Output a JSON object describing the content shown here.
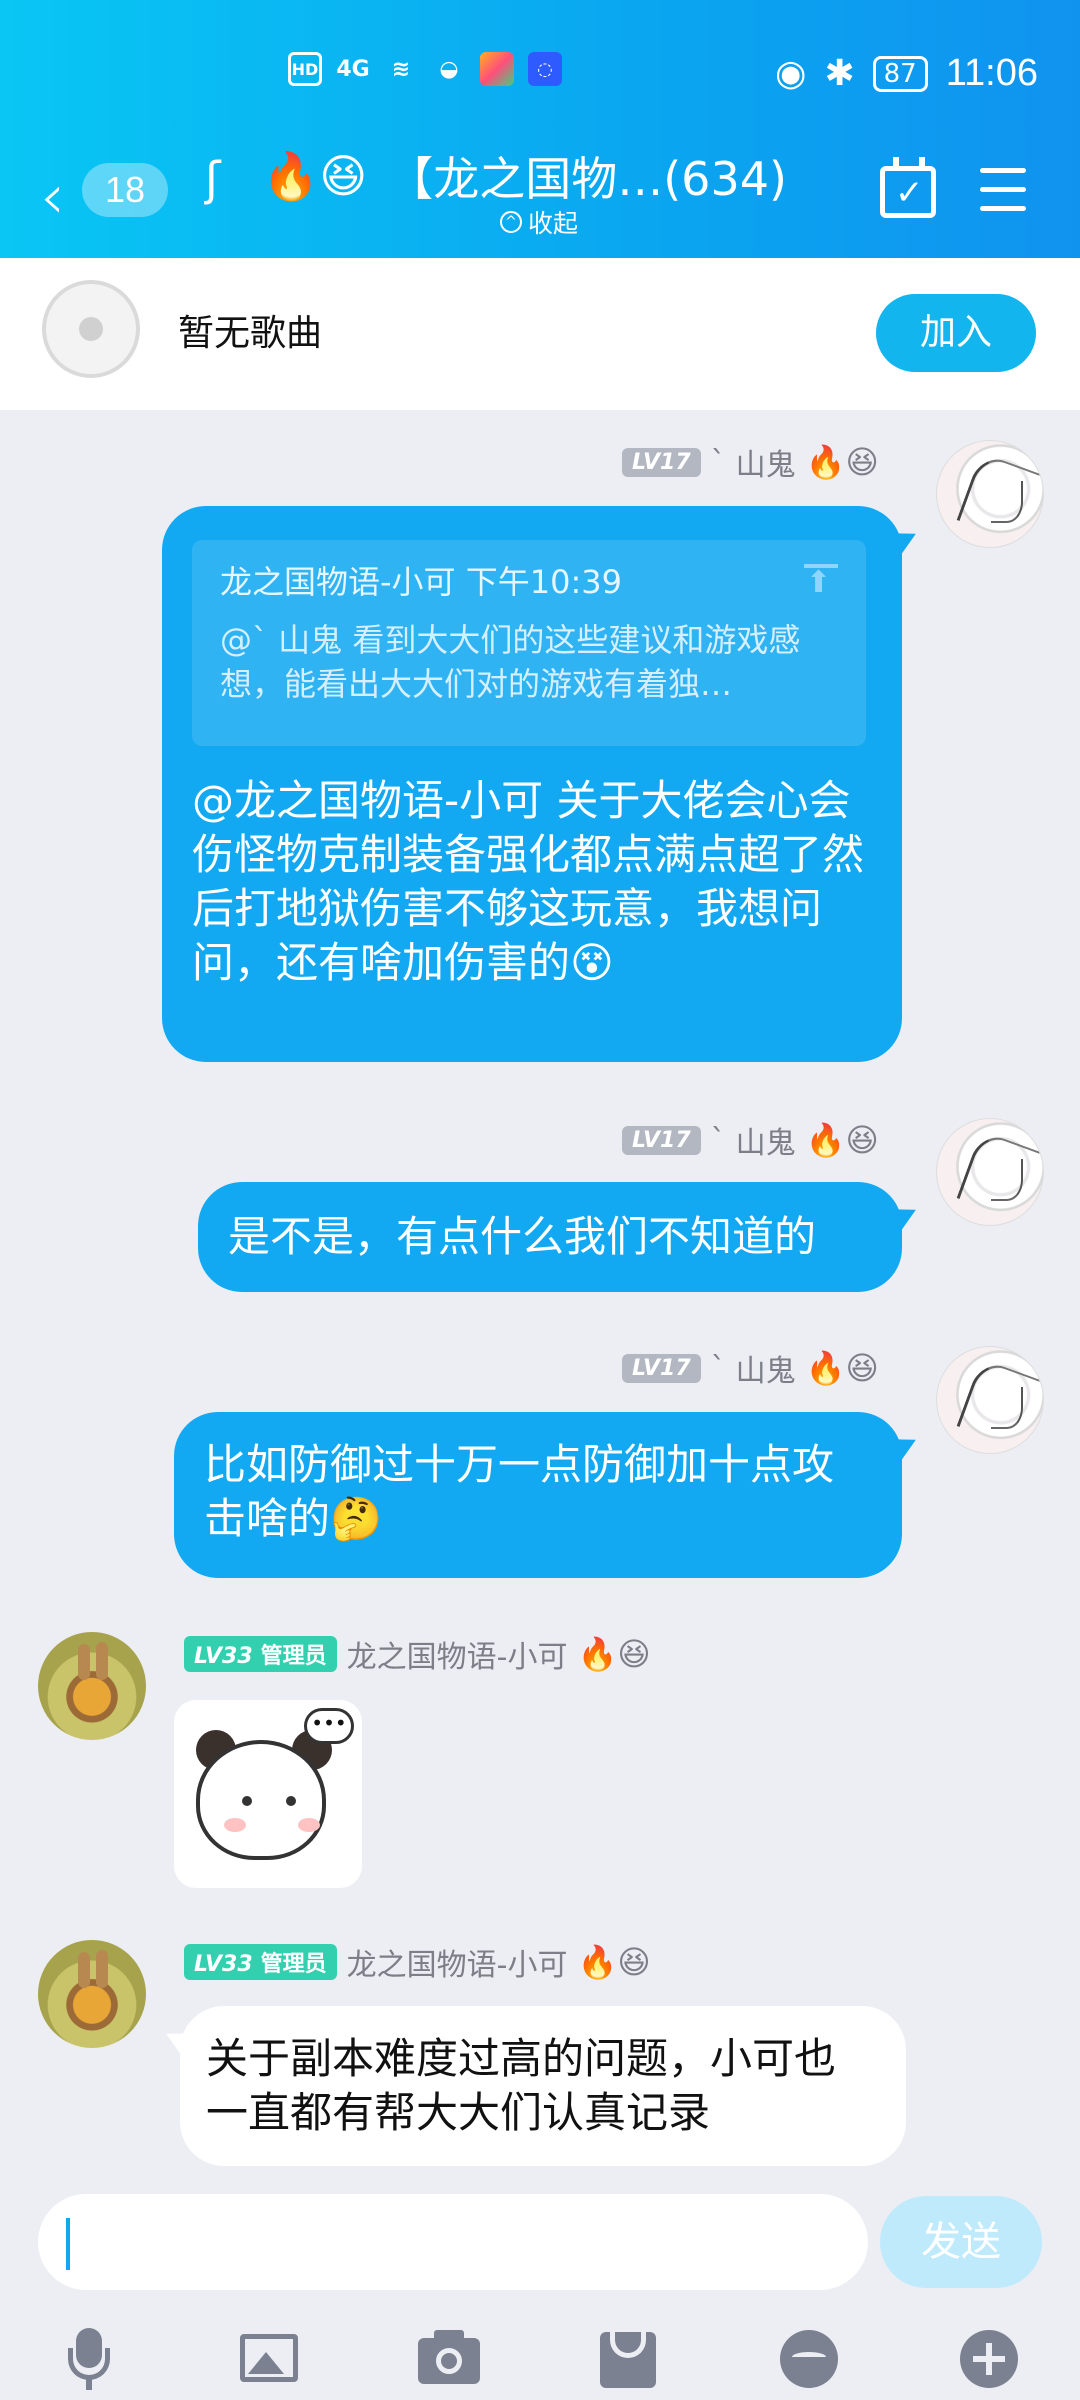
{
  "status_bar": {
    "hd": "HD",
    "signal": "4G",
    "battery": "87",
    "time": "11:06"
  },
  "header": {
    "back_count": "18",
    "title": "【龙之国物…(634)",
    "collapse": "收起",
    "title_emojis": "🔥😆",
    "accent": "#0aa6f0"
  },
  "music": {
    "text": "暂无歌曲",
    "join": "加入"
  },
  "messages": [
    {
      "sender": "山鬼",
      "sender_mark": "ˋ",
      "level": "LV17",
      "emojis": "🔥😆",
      "quote": {
        "author_time": "龙之国物语-小可 下午10:39",
        "text": "@ˋ 山鬼 看到大大们的这些建议和游戏感想，能看出大大们对的游戏有着独…"
      },
      "text": "@龙之国物语-小可 关于大佬会心会伤怪物克制装备强化都点满点超了然后打地狱伤害不够这玩意，我想问问，还有啥加伤害的😵"
    },
    {
      "sender": "山鬼",
      "sender_mark": "ˋ",
      "level": "LV17",
      "emojis": "🔥😆",
      "text": "是不是，有点什么我们不知道的"
    },
    {
      "sender": "山鬼",
      "sender_mark": "ˋ",
      "level": "LV17",
      "emojis": "🔥😆",
      "text": "比如防御过十万一点防御加十点攻击啥的🤔"
    },
    {
      "sender": "龙之国物语-小可",
      "level": "LV33",
      "role": "管理员",
      "emojis": "🔥😆",
      "sticker": "panda-sticker"
    },
    {
      "sender": "龙之国物语-小可",
      "level": "LV33",
      "role": "管理员",
      "emojis": "🔥😆",
      "text": "关于副本难度过高的问题，小可也一直都有帮大大们认真记录"
    }
  ],
  "input": {
    "value": "",
    "send": "发送"
  },
  "toolbar": [
    "mic-icon",
    "image-icon",
    "camera-icon",
    "red-packet-icon",
    "emoji-icon",
    "plus-icon"
  ]
}
